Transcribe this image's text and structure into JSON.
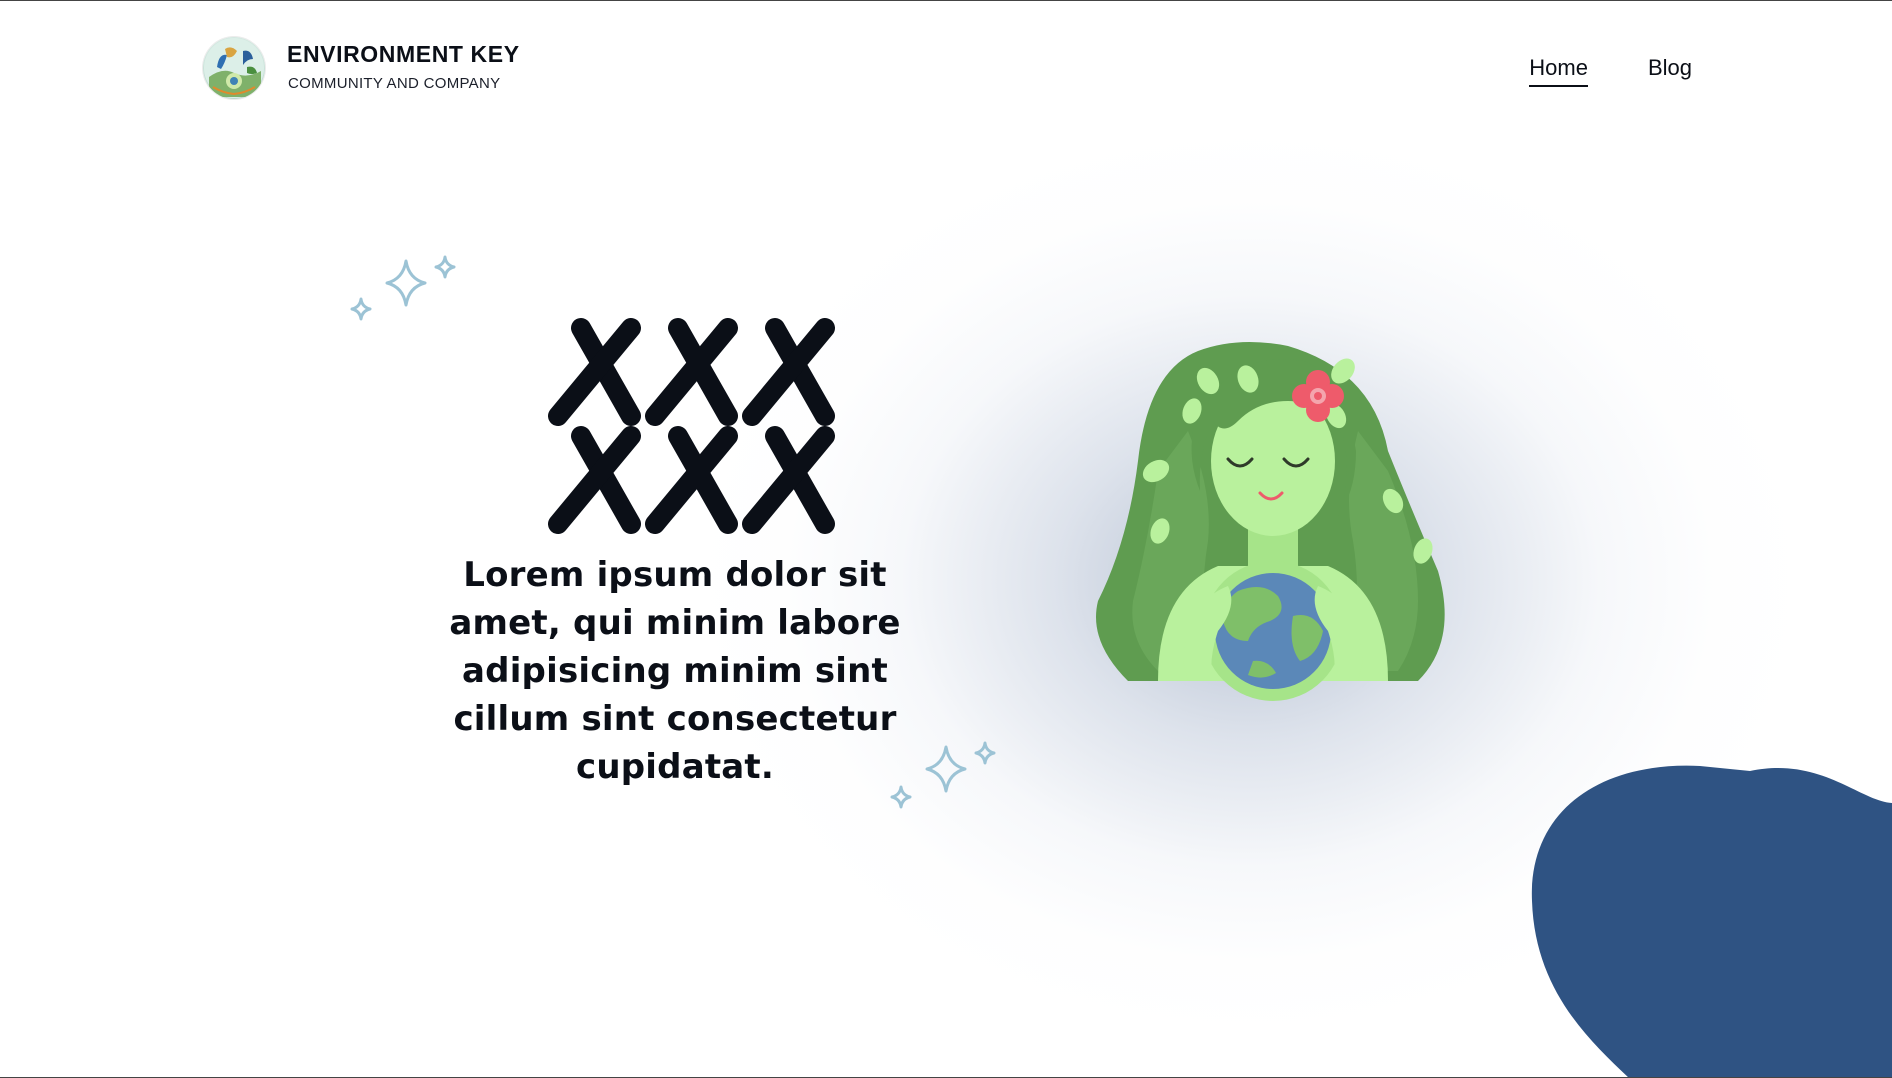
{
  "header": {
    "brand_title": "ENVIRONMENT KEY",
    "brand_subtitle": "COMMUNITY AND COMPANY",
    "logo_icon": "environment-key-logo",
    "nav": [
      {
        "label": "Home",
        "active": true
      },
      {
        "label": "Blog",
        "active": false
      }
    ]
  },
  "hero": {
    "mark_text": "XXX XXX",
    "body": "Lorem ipsum dolor sit amet, qui minim labore adipisicing minim sint cillum sint consectetur cupidatat.",
    "illustration_icon": "mother-earth-illustration",
    "sparkle_icon": "sparkle-icon"
  },
  "colors": {
    "blob": "#2f5383",
    "sparkle": "#9cc3d5",
    "text": "#0b0f17",
    "hair_dark": "#5f9c50",
    "skin": "#b9f19d",
    "earth": "#5b88b8",
    "flower": "#ee5b6b"
  }
}
